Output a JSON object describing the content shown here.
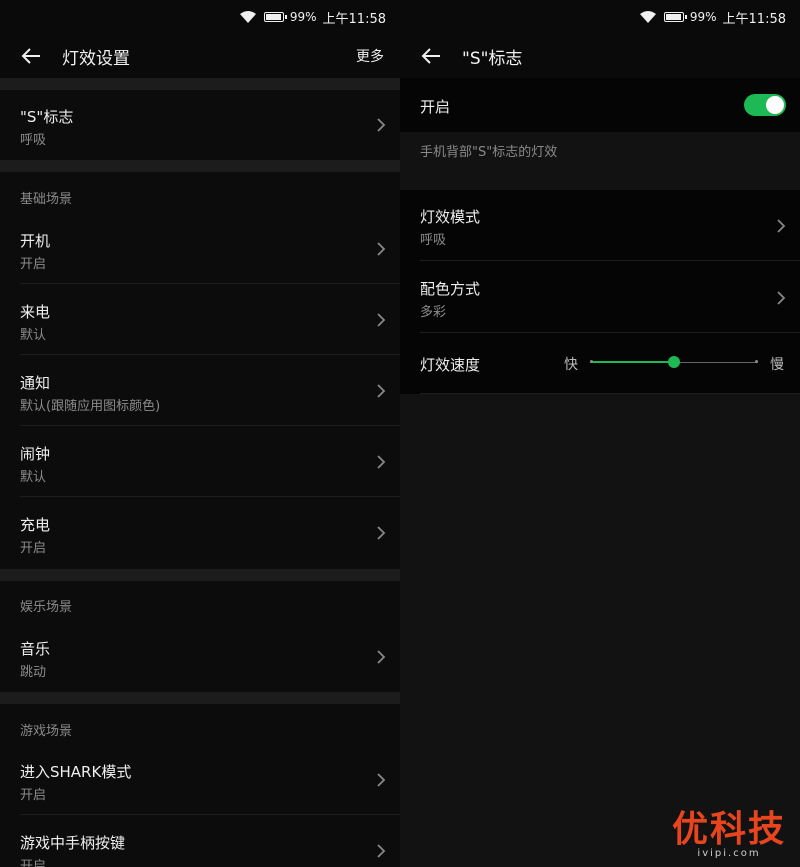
{
  "status_bar": {
    "battery": "99%",
    "time": "上午11:58"
  },
  "left": {
    "title": "灯效设置",
    "more": "更多",
    "top_item": {
      "label": "\"S\"标志",
      "value": "呼吸"
    },
    "sections": [
      {
        "label": "基础场景",
        "items": [
          {
            "label": "开机",
            "value": "开启"
          },
          {
            "label": "来电",
            "value": "默认"
          },
          {
            "label": "通知",
            "value": "默认(跟随应用图标颜色)"
          },
          {
            "label": "闹钟",
            "value": "默认"
          },
          {
            "label": "充电",
            "value": "开启"
          }
        ]
      },
      {
        "label": "娱乐场景",
        "items": [
          {
            "label": "音乐",
            "value": "跳动"
          }
        ]
      },
      {
        "label": "游戏场景",
        "items": [
          {
            "label": "进入SHARK模式",
            "value": "开启"
          },
          {
            "label": "游戏中手柄按键",
            "value": "开启"
          }
        ]
      }
    ]
  },
  "right": {
    "title": "\"S\"标志",
    "toggle": {
      "label": "开启",
      "on": true
    },
    "description": "手机背部\"S\"标志的灯效",
    "items": [
      {
        "label": "灯效模式",
        "value": "呼吸"
      },
      {
        "label": "配色方式",
        "value": "多彩"
      }
    ],
    "speed": {
      "label": "灯效速度",
      "fast": "快",
      "slow": "慢",
      "level": 0.5
    }
  },
  "watermark": {
    "logo": "优科技",
    "url": "ivipi.com"
  },
  "colors": {
    "accent": "#1db954",
    "watermark": "#e8451f"
  }
}
